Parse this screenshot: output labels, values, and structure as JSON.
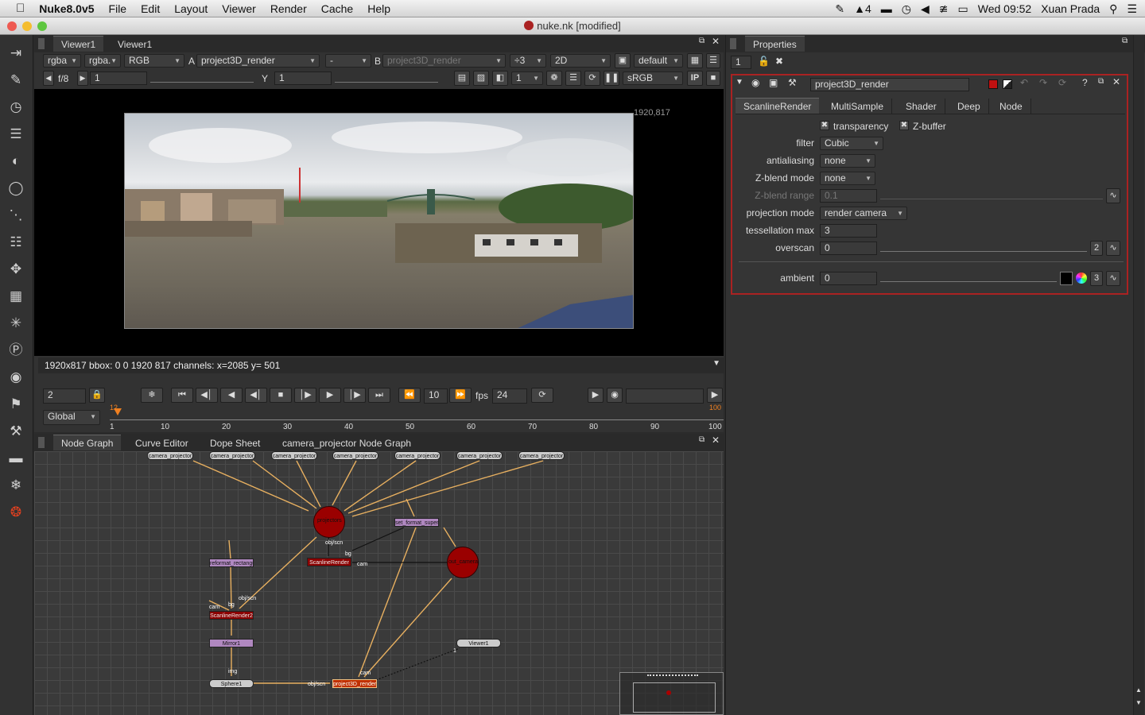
{
  "menubar": {
    "app_name": "Nuke8.0v5",
    "items": [
      "File",
      "Edit",
      "Layout",
      "Viewer",
      "Render",
      "Cache",
      "Help"
    ],
    "status_badge": "4",
    "clock": "Wed 09:52",
    "user": "Xuan Prada"
  },
  "window": {
    "title": "nuke.nk [modified]"
  },
  "viewer": {
    "tabs": [
      "Viewer1",
      "Viewer1"
    ],
    "channels": "rgba",
    "channels2": "rgba.",
    "display": "RGB",
    "a_label": "A",
    "a_input": "project3D_render",
    "mid_input": "-",
    "b_label": "B",
    "b_input": "project3D_render",
    "proxy": "÷3",
    "mode": "2D",
    "lut_default": "default",
    "fstop": "f/8",
    "gain": "1",
    "y_label": "Y",
    "gamma": "1",
    "frame_field": "1",
    "colorspace": "sRGB",
    "ip_label": "IP",
    "resolution_label": "1920,817",
    "info_bar": "1920x817 bbox: 0 0 1920 817 channels:  x=2085 y= 501"
  },
  "timeline": {
    "frame_increment": "2",
    "playback_step": "10",
    "fps_label": "fps",
    "fps": "24",
    "range_mode": "Global",
    "current_frame": "12",
    "end_frame_marker": "100",
    "ticks": [
      "1",
      "10",
      "20",
      "30",
      "40",
      "50",
      "60",
      "70",
      "80",
      "90",
      "100"
    ]
  },
  "graph": {
    "tabs": [
      "Node Graph",
      "Curve Editor",
      "Dope Sheet",
      "camera_projector Node Graph"
    ],
    "nodes": {
      "cam1": "camera_projector",
      "cam2": "camera_projector",
      "cam3": "camera_projector",
      "cam4": "camera_projector",
      "cam5": "camera_projector",
      "cam6": "camera_projector",
      "cam7": "camera_projector",
      "projectors": "projectors",
      "format": "set_format_superposition",
      "rect": "reformat_rectangular_format",
      "scanline": "ScanlineRender",
      "out_camera": "out_camera",
      "render2": "ScanlineRender2",
      "mirror": "Mirror1",
      "viewer": "Viewer1",
      "sphere": "Sphere1",
      "render": "project3D_render"
    },
    "pipe_labels": {
      "objscn1": "obj/scn",
      "bg": "bg",
      "cam": "cam",
      "objscn2": "obj/scn",
      "bg2": "bg",
      "cam2": "cam",
      "img": "img",
      "cam3": "cam",
      "objscn3": "obj/scn",
      "input1": "1"
    }
  },
  "properties": {
    "title": "Properties",
    "max_panels": "1",
    "node_name": "project3D_render",
    "tabs": [
      "ScanlineRender",
      "MultiSample",
      "Shader",
      "Deep",
      "Node"
    ],
    "transparency_label": "transparency",
    "zbuffer_label": "Z-buffer",
    "filter_label": "filter",
    "filter_value": "Cubic",
    "antialiasing_label": "antialiasing",
    "antialiasing_value": "none",
    "zblend_mode_label": "Z-blend mode",
    "zblend_mode_value": "none",
    "zblend_range_label": "Z-blend range",
    "zblend_range_value": "0.1",
    "projection_mode_label": "projection mode",
    "projection_mode_value": "render camera",
    "tess_max_label": "tessellation max",
    "tess_max_value": "3",
    "overscan_label": "overscan",
    "overscan_value": "0",
    "overscan_btn": "2",
    "ambient_label": "ambient",
    "ambient_value": "0",
    "ambient_btn": "3"
  },
  "colors": {
    "node_red": "#8b0000",
    "node_purple": "#b088c0",
    "pipe": "#e8b060",
    "accent_orange": "#f08020"
  }
}
